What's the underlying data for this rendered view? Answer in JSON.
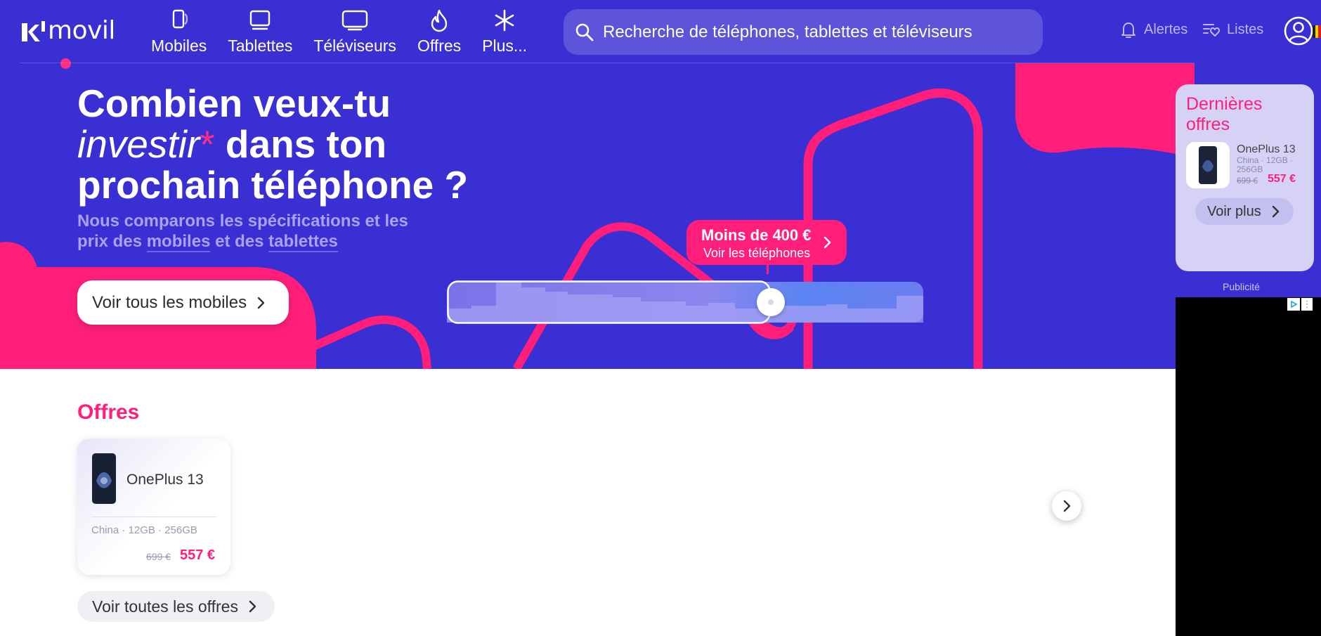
{
  "brand": {
    "name": "movil",
    "accent": "#ff1f7b",
    "hero_bg": "#3a2fd2"
  },
  "nav": {
    "items": [
      {
        "label": "Mobiles",
        "icon": "phone-icon"
      },
      {
        "label": "Tablettes",
        "icon": "tablet-icon"
      },
      {
        "label": "Téléviseurs",
        "icon": "tv-icon"
      },
      {
        "label": "Offres",
        "icon": "flame-icon"
      },
      {
        "label": "Plus...",
        "icon": "asterisk-icon"
      }
    ],
    "alerts_label": "Alertes",
    "lists_label": "Listes"
  },
  "search": {
    "placeholder": "Recherche de téléphones, tablettes et téléviseurs"
  },
  "hero": {
    "title_line1": "Combien veux-tu",
    "title_em": "investir",
    "title_star": "*",
    "title_line2_rest": " dans ton",
    "title_line3": "prochain téléphone ?",
    "sub_before": "Nous comparons les spécifications et les prix des ",
    "sub_link1": "mobiles",
    "sub_mid": " et des ",
    "sub_link2": "tablettes",
    "cta_label": "Voir tous les mobiles"
  },
  "budget": {
    "title": "Moins de 400 €",
    "subtitle": "Voir les téléphones",
    "slider_position": 0.68
  },
  "sidebar": {
    "title": "Dernières offres",
    "product": {
      "name": "OnePlus 13",
      "spec": "China · 12GB · 256GB",
      "old_price": "699 €",
      "price": "557 €"
    },
    "more_label": "Voir plus",
    "ad_label": "Publicité"
  },
  "offers": {
    "title": "Offres",
    "items": [
      {
        "name": "OnePlus 13",
        "spec": "China · 12GB · 256GB",
        "old_price": "699 €",
        "price": "557 €"
      }
    ],
    "all_label": "Voir toutes les offres"
  }
}
